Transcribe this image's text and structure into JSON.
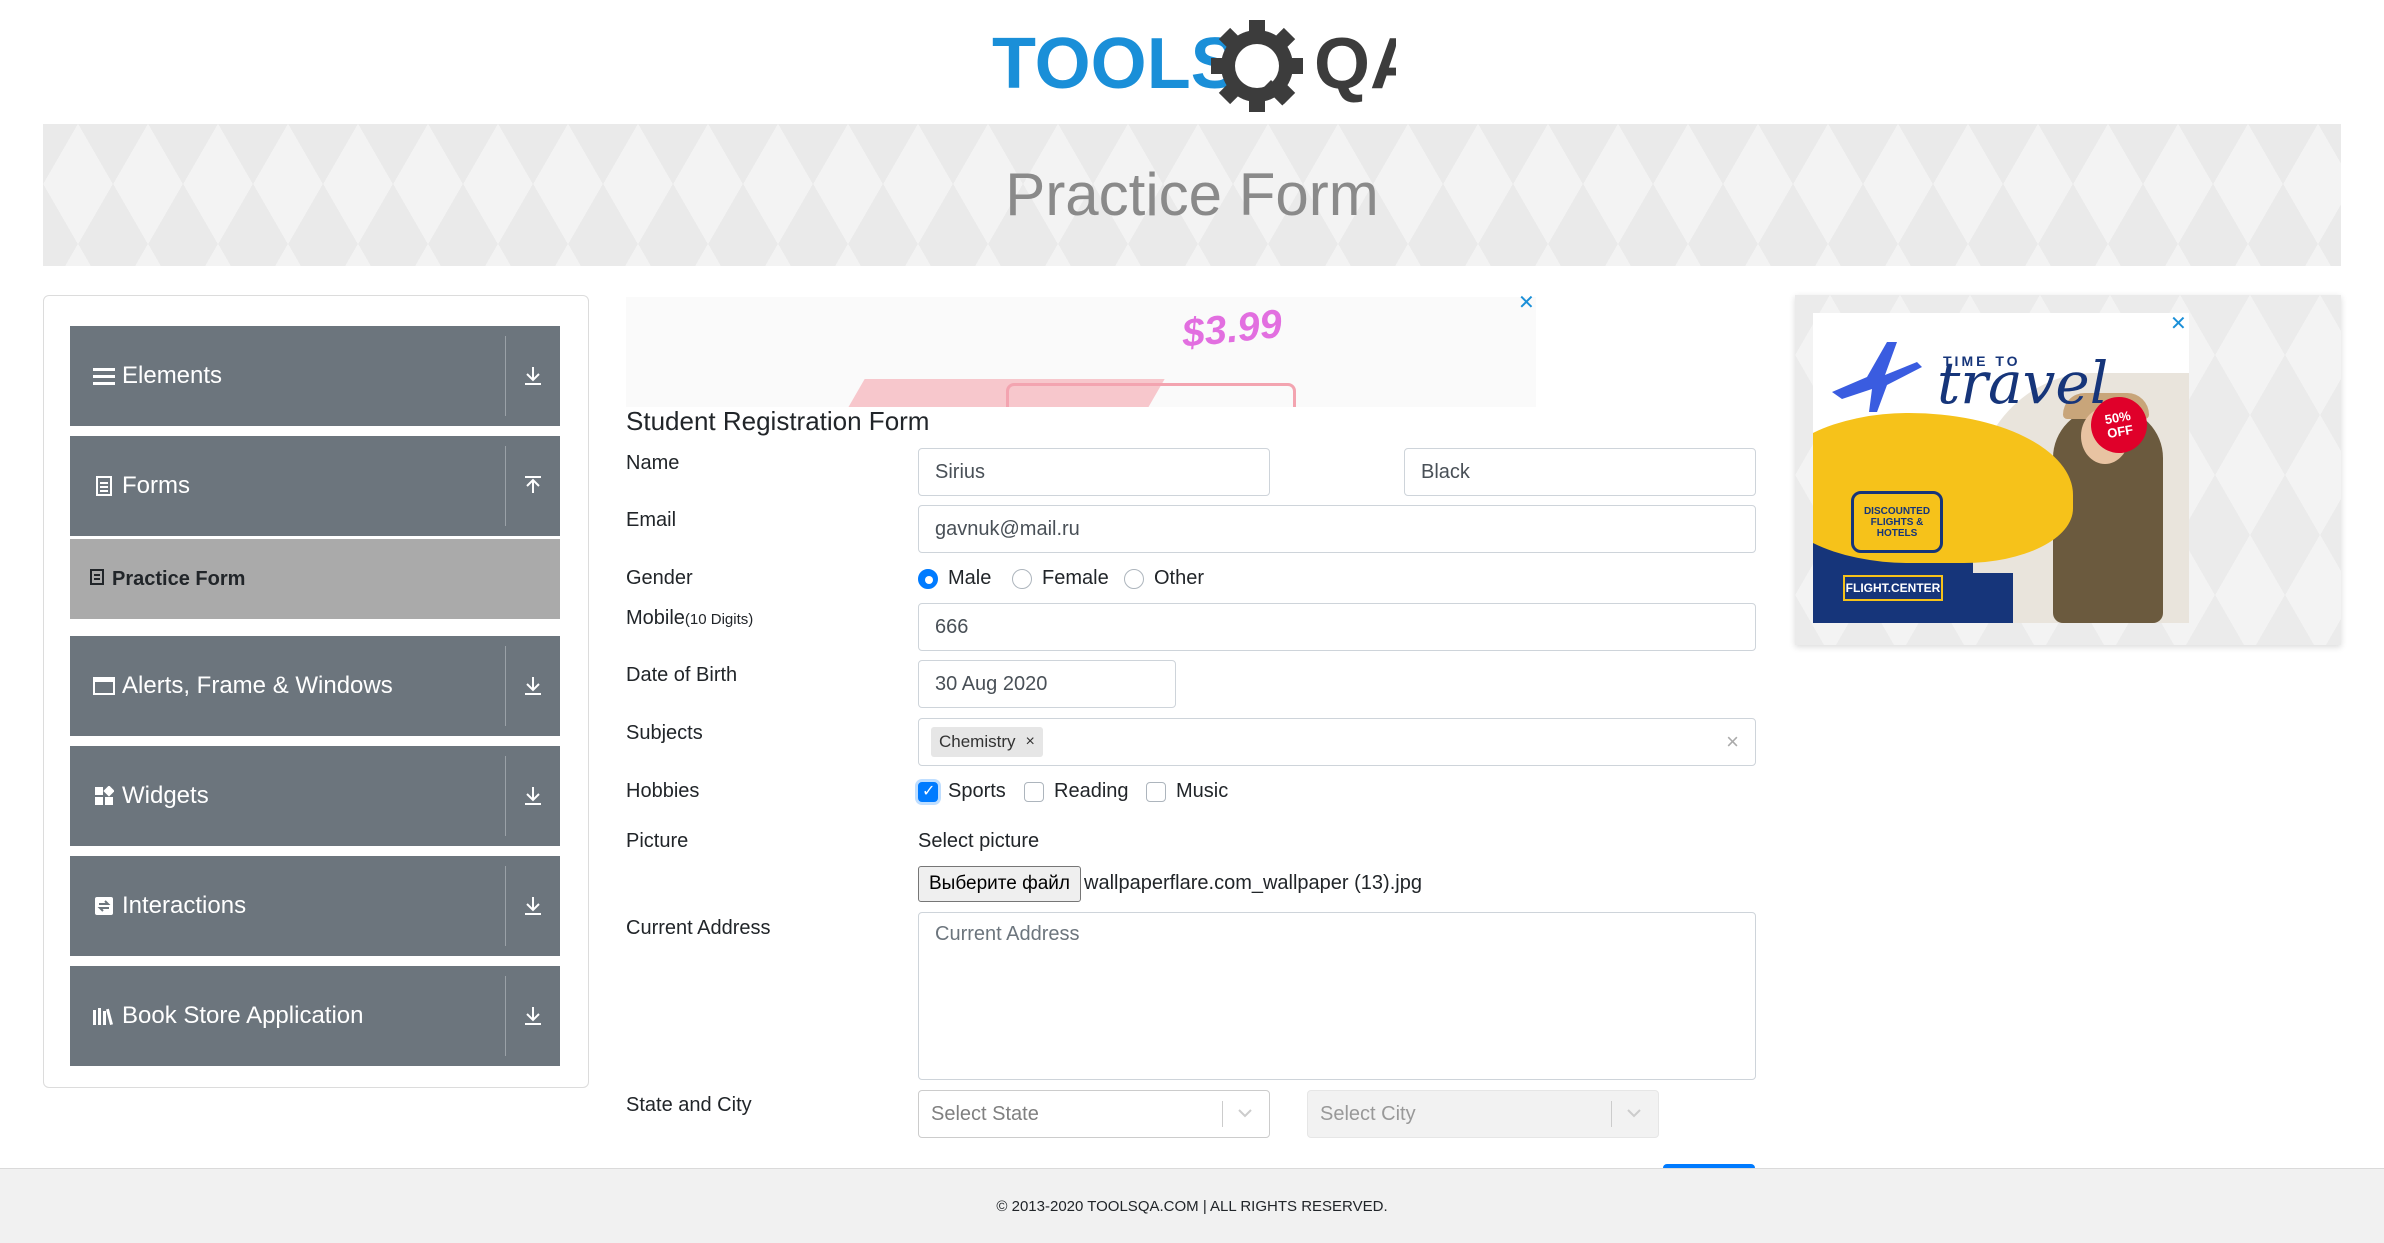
{
  "header": {
    "logo_text_left": "TOOLS",
    "logo_text_right": "QA",
    "page_title": "Practice Form"
  },
  "colors": {
    "sidebar_group_bg": "#6c757d",
    "sidebar_active_bg": "#aaaaaa",
    "accent_blue": "#007bff",
    "logo_blue": "#1a8fd8",
    "logo_dark": "#3c3c3c"
  },
  "sidebar": {
    "groups": [
      {
        "label": "Elements",
        "icon": "menu-icon",
        "arrow": "download-arrow-icon"
      },
      {
        "label": "Forms",
        "icon": "form-icon",
        "arrow": "upload-arrow-icon"
      },
      {
        "label": "Alerts, Frame & Windows",
        "icon": "window-icon",
        "arrow": "download-arrow-icon"
      },
      {
        "label": "Widgets",
        "icon": "widgets-icon",
        "arrow": "download-arrow-icon"
      },
      {
        "label": "Interactions",
        "icon": "interactions-icon",
        "arrow": "download-arrow-icon"
      },
      {
        "label": "Book Store Application",
        "icon": "books-icon",
        "arrow": "download-arrow-icon"
      }
    ],
    "active_item": {
      "label": "Practice Form",
      "icon": "form-icon"
    }
  },
  "ad_top": {
    "price": "$3.99",
    "close": "✕"
  },
  "form": {
    "title": "Student Registration Form",
    "name_label": "Name",
    "first_name": "Sirius",
    "last_name": "Black",
    "email_label": "Email",
    "email": "gavnuk@mail.ru",
    "gender_label": "Gender",
    "genders": [
      {
        "label": "Male",
        "checked": true
      },
      {
        "label": "Female",
        "checked": false
      },
      {
        "label": "Other",
        "checked": false
      }
    ],
    "mobile_label": "Mobile",
    "mobile_hint": "(10 Digits)",
    "mobile": "666",
    "dob_label": "Date of Birth",
    "dob": "30 Aug 2020",
    "subjects_label": "Subjects",
    "subject_chip": "Chemistry",
    "chip_remove": "×",
    "subjects_clear": "×",
    "hobbies_label": "Hobbies",
    "hobbies": [
      {
        "label": "Sports",
        "checked": true
      },
      {
        "label": "Reading",
        "checked": false
      },
      {
        "label": "Music",
        "checked": false
      }
    ],
    "picture_label": "Picture",
    "select_picture": "Select picture",
    "file_button": "Выберите файл",
    "file_name": "wallpaperflare.com_wallpaper (13).jpg",
    "address_label": "Current Address",
    "address_placeholder": "Current Address",
    "state_city_label": "State and City",
    "state_placeholder": "Select State",
    "city_placeholder": "Select City"
  },
  "ad_right": {
    "close": "✕",
    "time_to": "TIME TO",
    "travel": "travel",
    "discount_pct": "50%",
    "discount_off": "OFF",
    "discount_text": "DISCOUNTED FLIGHTS & HOTELS",
    "brand": "FLIGHT.CENTER"
  },
  "footer": {
    "text": "© 2013-2020 TOOLSQA.COM | ALL RIGHTS RESERVED."
  }
}
